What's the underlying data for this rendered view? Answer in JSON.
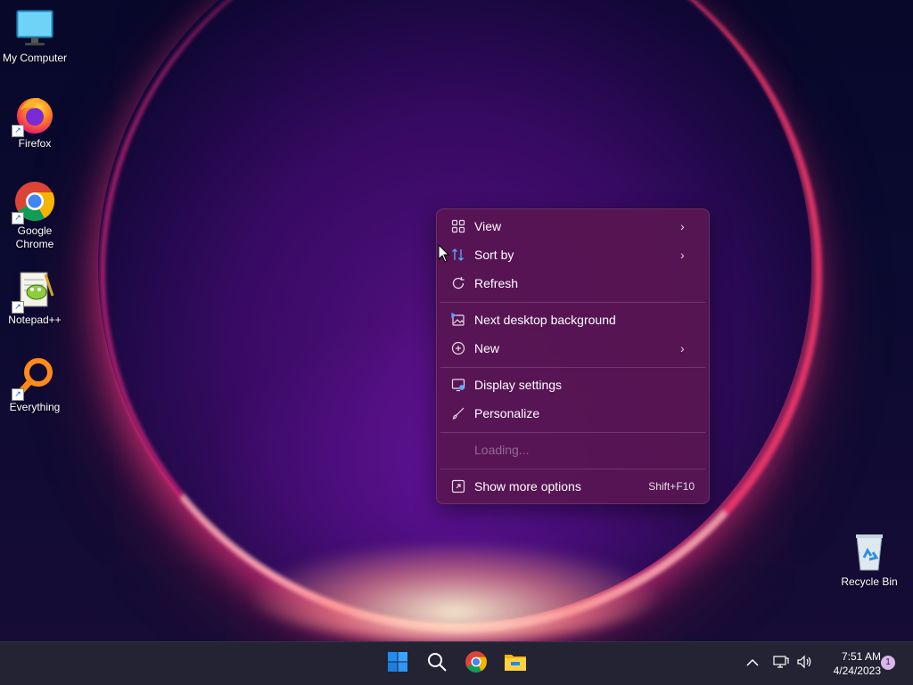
{
  "desktop": {
    "icons": [
      {
        "label": "My Computer",
        "icon": "monitor-icon"
      },
      {
        "label": "Firefox",
        "icon": "firefox-icon"
      },
      {
        "label": "Google Chrome",
        "icon": "chrome-icon"
      },
      {
        "label": "Notepad++",
        "icon": "notepadpp-icon"
      },
      {
        "label": "Everything",
        "icon": "magnifier-icon"
      },
      {
        "label": "Recycle Bin",
        "icon": "recycle-bin-icon"
      }
    ]
  },
  "context_menu": {
    "items": [
      {
        "label": "View",
        "icon": "grid-icon",
        "submenu": true
      },
      {
        "label": "Sort by",
        "icon": "sort-icon",
        "submenu": true
      },
      {
        "label": "Refresh",
        "icon": "refresh-icon"
      },
      {
        "label": "Next desktop background",
        "icon": "next-background-icon"
      },
      {
        "label": "New",
        "icon": "plus-circle-icon",
        "submenu": true
      },
      {
        "label": "Display settings",
        "icon": "display-settings-icon"
      },
      {
        "label": "Personalize",
        "icon": "brush-icon"
      },
      {
        "label": "Loading...",
        "disabled": true
      },
      {
        "label": "Show more options",
        "icon": "more-options-icon",
        "shortcut": "Shift+F10"
      }
    ]
  },
  "taskbar": {
    "apps": [
      "start-icon",
      "search-icon",
      "chrome-icon",
      "file-explorer-icon"
    ],
    "tray": {
      "time": "7:51 AM",
      "date": "4/24/2023",
      "notifications": "1"
    }
  },
  "colors": {
    "menu_bg": "#581652",
    "taskbar_bg": "#232334",
    "accent_blue": "#1f8cf2"
  }
}
